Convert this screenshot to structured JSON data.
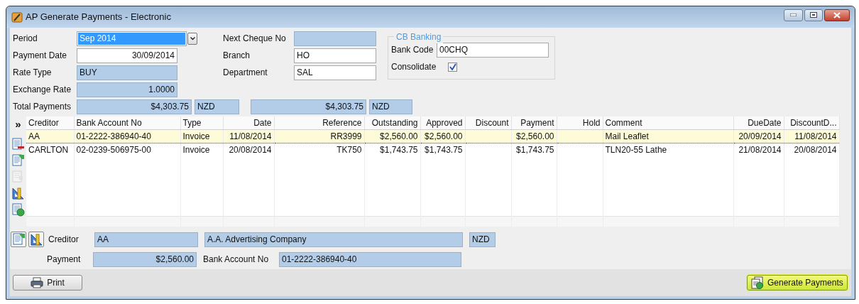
{
  "window": {
    "title": "AP Generate Payments - Electronic"
  },
  "form": {
    "period": {
      "label": "Period",
      "value": "Sep 2014",
      "text_selected": true
    },
    "payment_date": {
      "label": "Payment Date",
      "value": "30/09/2014",
      "kind": "input"
    },
    "rate_type": {
      "label": "Rate Type",
      "value": "BUY",
      "kind": "readonly"
    },
    "exchange_rate": {
      "label": "Exchange Rate",
      "value": "1.0000",
      "kind": "readonly"
    },
    "next_cheque_no": {
      "label": "Next Cheque No",
      "kind": "readonly"
    },
    "branch": {
      "label": "Branch",
      "value": "HO",
      "kind": "input"
    },
    "department": {
      "label": "Department",
      "value": "SAL",
      "kind": "input"
    },
    "total_payments": {
      "label": "Total Payments",
      "amount": "$4,303.75",
      "currency": "NZD",
      "amount_2": "$4,303.75",
      "currency_2": "NZD"
    }
  },
  "cb_banking": {
    "title": "CB Banking",
    "bank_code": {
      "label": "Bank Code",
      "value": "00CHQ",
      "kind": "input"
    },
    "consolidate": {
      "label": "Consolidate",
      "checked": true
    }
  },
  "side_tools": [
    {
      "kind": "expand",
      "label": "»"
    },
    {
      "kind": "remove",
      "disabled": false
    },
    {
      "kind": "export",
      "disabled": false
    },
    {
      "kind": "import",
      "disabled": true
    },
    {
      "kind": "ruler",
      "disabled": false
    },
    {
      "kind": "refresh",
      "disabled": false
    }
  ],
  "table": {
    "columns": [
      "Creditor",
      "Bank Account No",
      "Type",
      "Date",
      "Reference",
      "Outstanding",
      "Approved",
      "Discount",
      "Payment",
      "Hold",
      "Comment",
      "DueDate",
      "DiscountD..."
    ],
    "rows": [
      {
        "selected": true,
        "cells": [
          "AA",
          "01-2222-386940-40",
          "Invoice",
          "11/08/2014",
          "RR3999",
          "$2,560.00",
          "$2,560.00",
          null,
          "$2,560.00",
          null,
          "Mail Leaflet",
          "20/09/2014",
          "11/08/2014"
        ]
      },
      {
        "selected": false,
        "cells": [
          "CARLTON",
          "02-0239-506975-00",
          "Invoice",
          "20/08/2014",
          "TK750",
          "$1,743.75",
          "$1,743.75",
          null,
          "$1,743.75",
          null,
          "TLN20-55 Lathe",
          "21/08/2014",
          "20/08/2014"
        ]
      }
    ]
  },
  "detail": {
    "creditor": {
      "label": "Creditor",
      "code": "AA",
      "name": "A.A. Advertising Company",
      "currency": "NZD"
    },
    "payment": {
      "label": "Payment",
      "value": "$2,560.00"
    },
    "bank_account": {
      "label": "Bank Account No",
      "value": "01-2222-386940-40"
    }
  },
  "buttons": [
    {
      "kind": "print",
      "label": "Print",
      "hover": false
    },
    {
      "kind": "generate",
      "label": "Generate Payments",
      "hover": true
    }
  ]
}
